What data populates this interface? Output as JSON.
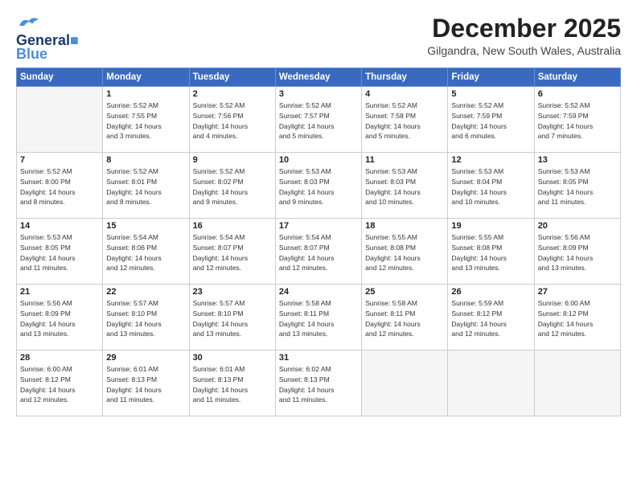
{
  "logo": {
    "line1": "General",
    "line2": "Blue"
  },
  "title": "December 2025",
  "subtitle": "Gilgandra, New South Wales, Australia",
  "days_header": [
    "Sunday",
    "Monday",
    "Tuesday",
    "Wednesday",
    "Thursday",
    "Friday",
    "Saturday"
  ],
  "weeks": [
    [
      {
        "day": "",
        "info": ""
      },
      {
        "day": "1",
        "info": "Sunrise: 5:52 AM\nSunset: 7:55 PM\nDaylight: 14 hours\nand 3 minutes."
      },
      {
        "day": "2",
        "info": "Sunrise: 5:52 AM\nSunset: 7:56 PM\nDaylight: 14 hours\nand 4 minutes."
      },
      {
        "day": "3",
        "info": "Sunrise: 5:52 AM\nSunset: 7:57 PM\nDaylight: 14 hours\nand 5 minutes."
      },
      {
        "day": "4",
        "info": "Sunrise: 5:52 AM\nSunset: 7:58 PM\nDaylight: 14 hours\nand 5 minutes."
      },
      {
        "day": "5",
        "info": "Sunrise: 5:52 AM\nSunset: 7:59 PM\nDaylight: 14 hours\nand 6 minutes."
      },
      {
        "day": "6",
        "info": "Sunrise: 5:52 AM\nSunset: 7:59 PM\nDaylight: 14 hours\nand 7 minutes."
      }
    ],
    [
      {
        "day": "7",
        "info": "Sunrise: 5:52 AM\nSunset: 8:00 PM\nDaylight: 14 hours\nand 8 minutes."
      },
      {
        "day": "8",
        "info": "Sunrise: 5:52 AM\nSunset: 8:01 PM\nDaylight: 14 hours\nand 8 minutes."
      },
      {
        "day": "9",
        "info": "Sunrise: 5:52 AM\nSunset: 8:02 PM\nDaylight: 14 hours\nand 9 minutes."
      },
      {
        "day": "10",
        "info": "Sunrise: 5:53 AM\nSunset: 8:03 PM\nDaylight: 14 hours\nand 9 minutes."
      },
      {
        "day": "11",
        "info": "Sunrise: 5:53 AM\nSunset: 8:03 PM\nDaylight: 14 hours\nand 10 minutes."
      },
      {
        "day": "12",
        "info": "Sunrise: 5:53 AM\nSunset: 8:04 PM\nDaylight: 14 hours\nand 10 minutes."
      },
      {
        "day": "13",
        "info": "Sunrise: 5:53 AM\nSunset: 8:05 PM\nDaylight: 14 hours\nand 11 minutes."
      }
    ],
    [
      {
        "day": "14",
        "info": "Sunrise: 5:53 AM\nSunset: 8:05 PM\nDaylight: 14 hours\nand 11 minutes."
      },
      {
        "day": "15",
        "info": "Sunrise: 5:54 AM\nSunset: 8:06 PM\nDaylight: 14 hours\nand 12 minutes."
      },
      {
        "day": "16",
        "info": "Sunrise: 5:54 AM\nSunset: 8:07 PM\nDaylight: 14 hours\nand 12 minutes."
      },
      {
        "day": "17",
        "info": "Sunrise: 5:54 AM\nSunset: 8:07 PM\nDaylight: 14 hours\nand 12 minutes."
      },
      {
        "day": "18",
        "info": "Sunrise: 5:55 AM\nSunset: 8:08 PM\nDaylight: 14 hours\nand 12 minutes."
      },
      {
        "day": "19",
        "info": "Sunrise: 5:55 AM\nSunset: 8:08 PM\nDaylight: 14 hours\nand 13 minutes."
      },
      {
        "day": "20",
        "info": "Sunrise: 5:56 AM\nSunset: 8:09 PM\nDaylight: 14 hours\nand 13 minutes."
      }
    ],
    [
      {
        "day": "21",
        "info": "Sunrise: 5:56 AM\nSunset: 8:09 PM\nDaylight: 14 hours\nand 13 minutes."
      },
      {
        "day": "22",
        "info": "Sunrise: 5:57 AM\nSunset: 8:10 PM\nDaylight: 14 hours\nand 13 minutes."
      },
      {
        "day": "23",
        "info": "Sunrise: 5:57 AM\nSunset: 8:10 PM\nDaylight: 14 hours\nand 13 minutes."
      },
      {
        "day": "24",
        "info": "Sunrise: 5:58 AM\nSunset: 8:11 PM\nDaylight: 14 hours\nand 13 minutes."
      },
      {
        "day": "25",
        "info": "Sunrise: 5:58 AM\nSunset: 8:11 PM\nDaylight: 14 hours\nand 12 minutes."
      },
      {
        "day": "26",
        "info": "Sunrise: 5:59 AM\nSunset: 8:12 PM\nDaylight: 14 hours\nand 12 minutes."
      },
      {
        "day": "27",
        "info": "Sunrise: 6:00 AM\nSunset: 8:12 PM\nDaylight: 14 hours\nand 12 minutes."
      }
    ],
    [
      {
        "day": "28",
        "info": "Sunrise: 6:00 AM\nSunset: 8:12 PM\nDaylight: 14 hours\nand 12 minutes."
      },
      {
        "day": "29",
        "info": "Sunrise: 6:01 AM\nSunset: 8:13 PM\nDaylight: 14 hours\nand 11 minutes."
      },
      {
        "day": "30",
        "info": "Sunrise: 6:01 AM\nSunset: 8:13 PM\nDaylight: 14 hours\nand 11 minutes."
      },
      {
        "day": "31",
        "info": "Sunrise: 6:02 AM\nSunset: 8:13 PM\nDaylight: 14 hours\nand 11 minutes."
      },
      {
        "day": "",
        "info": ""
      },
      {
        "day": "",
        "info": ""
      },
      {
        "day": "",
        "info": ""
      }
    ]
  ]
}
